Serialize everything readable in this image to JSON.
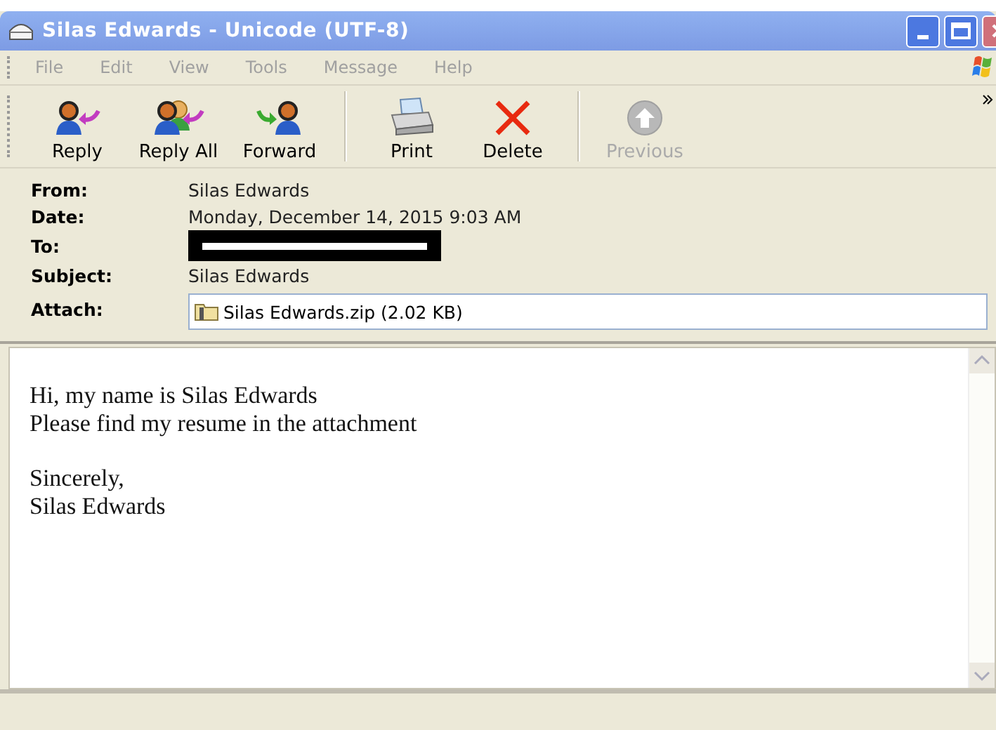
{
  "window": {
    "title": "Silas Edwards - Unicode (UTF-8)"
  },
  "menu": [
    {
      "label": "File"
    },
    {
      "label": "Edit"
    },
    {
      "label": "View"
    },
    {
      "label": "Tools"
    },
    {
      "label": "Message"
    },
    {
      "label": "Help"
    }
  ],
  "toolbar": [
    {
      "label": "Reply",
      "kind": "reply",
      "disabled": false,
      "separator_after": false
    },
    {
      "label": "Reply All",
      "kind": "reply_all",
      "disabled": false,
      "separator_after": false
    },
    {
      "label": "Forward",
      "kind": "forward",
      "disabled": false,
      "separator_after": true
    },
    {
      "label": "Print",
      "kind": "print",
      "disabled": false,
      "separator_after": false
    },
    {
      "label": "Delete",
      "kind": "delete",
      "disabled": false,
      "separator_after": true
    },
    {
      "label": "Previous",
      "kind": "previous",
      "disabled": true,
      "separator_after": false
    }
  ],
  "header": [
    {
      "label": "From:",
      "kind": "text",
      "value": "Silas Edwards"
    },
    {
      "label": "Date:",
      "kind": "text",
      "value": "Monday, December 14, 2015 9:03 AM"
    },
    {
      "label": "To:",
      "kind": "redacted"
    },
    {
      "label": "Subject:",
      "kind": "text",
      "value": "Silas Edwards"
    },
    {
      "label": "Attach:",
      "kind": "attachment",
      "value": "Silas Edwards.zip (2.02 KB)"
    }
  ],
  "body": {
    "paragraphs": [
      [
        "Hi, my name is Silas Edwards",
        "Please find my resume in the attachment"
      ],
      [
        "Sincerely,",
        "Silas Edwards"
      ]
    ]
  }
}
